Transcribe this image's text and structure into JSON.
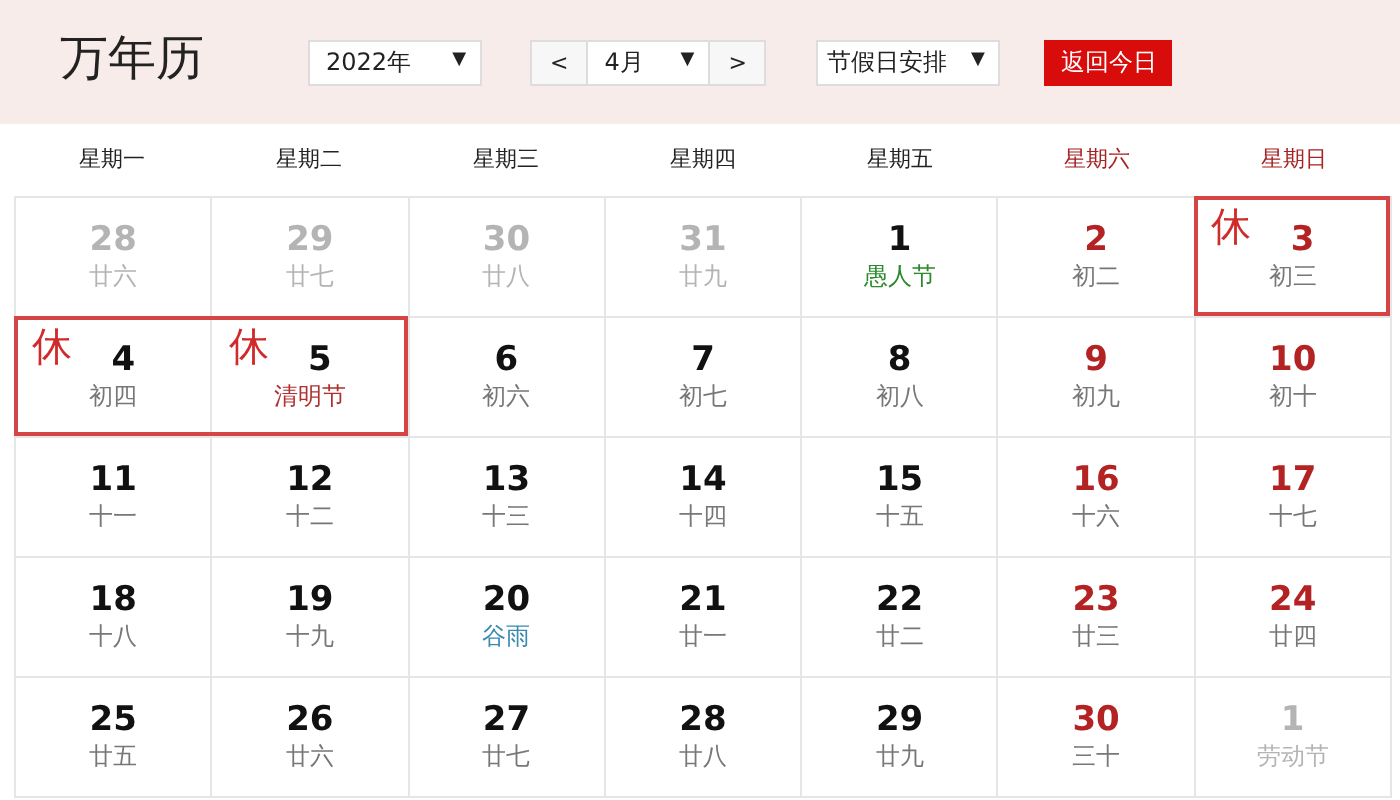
{
  "title": "万年历",
  "controls": {
    "year": {
      "value": "2022年",
      "arrow": "▼"
    },
    "prev": "<",
    "month": {
      "value": "4月",
      "arrow": "▼"
    },
    "next": ">",
    "holiday": {
      "value": "节假日安排",
      "arrow": "▼"
    },
    "today_button": "返回今日"
  },
  "weekdays": [
    {
      "label": "星期一",
      "weekend": false
    },
    {
      "label": "星期二",
      "weekend": false
    },
    {
      "label": "星期三",
      "weekend": false
    },
    {
      "label": "星期四",
      "weekend": false
    },
    {
      "label": "星期五",
      "weekend": false
    },
    {
      "label": "星期六",
      "weekend": true
    },
    {
      "label": "星期日",
      "weekend": true
    }
  ],
  "weeks": [
    [
      {
        "day": "28",
        "sub": "廿六",
        "other_month": true,
        "kind": "lunar"
      },
      {
        "day": "29",
        "sub": "廿七",
        "other_month": true,
        "kind": "lunar"
      },
      {
        "day": "30",
        "sub": "廿八",
        "other_month": true,
        "kind": "lunar"
      },
      {
        "day": "31",
        "sub": "廿九",
        "other_month": true,
        "kind": "lunar"
      },
      {
        "day": "1",
        "sub": "愚人节",
        "other_month": false,
        "weekend": false,
        "kind": "festival"
      },
      {
        "day": "2",
        "sub": "初二",
        "other_month": false,
        "weekend": true,
        "kind": "lunar"
      },
      {
        "day": "3",
        "sub": "初三",
        "other_month": false,
        "weekend": true,
        "kind": "lunar",
        "rest": "休"
      }
    ],
    [
      {
        "day": "4",
        "sub": "初四",
        "other_month": false,
        "weekend": false,
        "kind": "lunar",
        "rest": "休"
      },
      {
        "day": "5",
        "sub": "清明节",
        "other_month": false,
        "weekend": false,
        "kind": "holiday",
        "rest": "休"
      },
      {
        "day": "6",
        "sub": "初六",
        "other_month": false,
        "weekend": false,
        "kind": "lunar"
      },
      {
        "day": "7",
        "sub": "初七",
        "other_month": false,
        "weekend": false,
        "kind": "lunar"
      },
      {
        "day": "8",
        "sub": "初八",
        "other_month": false,
        "weekend": false,
        "kind": "lunar"
      },
      {
        "day": "9",
        "sub": "初九",
        "other_month": false,
        "weekend": true,
        "kind": "lunar"
      },
      {
        "day": "10",
        "sub": "初十",
        "other_month": false,
        "weekend": true,
        "kind": "lunar"
      }
    ],
    [
      {
        "day": "11",
        "sub": "十一",
        "other_month": false,
        "weekend": false,
        "kind": "lunar"
      },
      {
        "day": "12",
        "sub": "十二",
        "other_month": false,
        "weekend": false,
        "kind": "lunar"
      },
      {
        "day": "13",
        "sub": "十三",
        "other_month": false,
        "weekend": false,
        "kind": "lunar"
      },
      {
        "day": "14",
        "sub": "十四",
        "other_month": false,
        "weekend": false,
        "kind": "lunar"
      },
      {
        "day": "15",
        "sub": "十五",
        "other_month": false,
        "weekend": false,
        "kind": "lunar"
      },
      {
        "day": "16",
        "sub": "十六",
        "other_month": false,
        "weekend": true,
        "kind": "lunar"
      },
      {
        "day": "17",
        "sub": "十七",
        "other_month": false,
        "weekend": true,
        "kind": "lunar"
      }
    ],
    [
      {
        "day": "18",
        "sub": "十八",
        "other_month": false,
        "weekend": false,
        "kind": "lunar"
      },
      {
        "day": "19",
        "sub": "十九",
        "other_month": false,
        "weekend": false,
        "kind": "lunar"
      },
      {
        "day": "20",
        "sub": "谷雨",
        "other_month": false,
        "weekend": false,
        "kind": "term"
      },
      {
        "day": "21",
        "sub": "廿一",
        "other_month": false,
        "weekend": false,
        "kind": "lunar"
      },
      {
        "day": "22",
        "sub": "廿二",
        "other_month": false,
        "weekend": false,
        "kind": "lunar"
      },
      {
        "day": "23",
        "sub": "廿三",
        "other_month": false,
        "weekend": true,
        "kind": "lunar"
      },
      {
        "day": "24",
        "sub": "廿四",
        "other_month": false,
        "weekend": true,
        "kind": "lunar"
      }
    ],
    [
      {
        "day": "25",
        "sub": "廿五",
        "other_month": false,
        "weekend": false,
        "kind": "lunar"
      },
      {
        "day": "26",
        "sub": "廿六",
        "other_month": false,
        "weekend": false,
        "kind": "lunar"
      },
      {
        "day": "27",
        "sub": "廿七",
        "other_month": false,
        "weekend": false,
        "kind": "lunar"
      },
      {
        "day": "28",
        "sub": "廿八",
        "other_month": false,
        "weekend": false,
        "kind": "lunar"
      },
      {
        "day": "29",
        "sub": "廿九",
        "other_month": false,
        "weekend": false,
        "kind": "lunar"
      },
      {
        "day": "30",
        "sub": "三十",
        "other_month": false,
        "weekend": true,
        "kind": "lunar"
      },
      {
        "day": "1",
        "sub": "劳动节",
        "other_month": true,
        "kind": "holiday"
      }
    ]
  ]
}
